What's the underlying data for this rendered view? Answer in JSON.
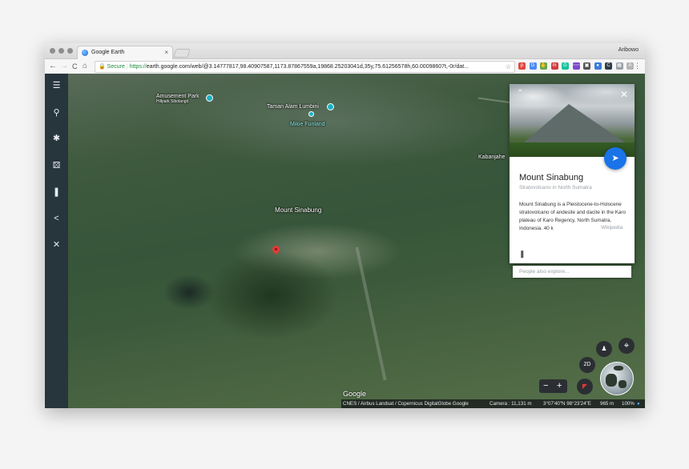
{
  "browser": {
    "tab_title": "Google Earth",
    "tab_close": "×",
    "user": "Aribowo",
    "nav": {
      "back": "←",
      "forward": "→",
      "reload": "C",
      "home": "⌂"
    },
    "secure_label": "Secure",
    "url_scheme": "https://",
    "url": "earth.google.com/web/@3.14777817,98.40907587,1173.87867559a,19868.25203041d,35y,75.61256578h,60.00098607t,-0r/dat...",
    "star": "☆",
    "extensions": [
      {
        "name": "pocket-ext",
        "glyph": "p",
        "color": "#e0463f"
      },
      {
        "name": "translate-ext",
        "glyph": "G",
        "color": "#4c8bf5"
      },
      {
        "name": "hand-ext",
        "glyph": "✋",
        "color": "#6aa84f"
      },
      {
        "name": "m-ext",
        "glyph": "m",
        "color": "#d23c3c"
      },
      {
        "name": "grammarly-ext",
        "glyph": "G",
        "color": "#15c39a"
      },
      {
        "name": "wappalyzer-ext",
        "glyph": "~~~",
        "color": "#7a49c9"
      },
      {
        "name": "stack-ext",
        "glyph": "▣",
        "color": "#555555"
      },
      {
        "name": "dot-ext",
        "glyph": "●",
        "color": "#3a7bd5"
      },
      {
        "name": "c-ext",
        "glyph": "C",
        "color": "#2d3b45"
      },
      {
        "name": "grid-ext",
        "glyph": "▦",
        "color": "#9aa0a6"
      },
      {
        "name": "a-ext",
        "glyph": "A",
        "color": "#b5b5b5"
      }
    ],
    "menu": "⋮"
  },
  "rail": [
    {
      "name": "menu-icon",
      "glyph": "☰"
    },
    {
      "name": "search-icon",
      "glyph": "⚲"
    },
    {
      "name": "voyager-icon",
      "glyph": "✱"
    },
    {
      "name": "random-dice-icon",
      "glyph": "⚄"
    },
    {
      "name": "bookmark-icon",
      "glyph": "❚"
    },
    {
      "name": "share-icon",
      "glyph": "<"
    },
    {
      "name": "measure-icon",
      "glyph": "✕"
    }
  ],
  "map": {
    "places": {
      "amusement_park": "Amusement Park",
      "hillpark": "Hillpark Sibolangit",
      "taman": "Taman Alam Lumbini",
      "mikie": "Mikie Funland",
      "kabanjahe": "Kabanjahe",
      "mount": "Mount Sinabung"
    },
    "google_logo": "Google"
  },
  "card": {
    "title": "Mount Sinabung",
    "subtitle": "Stratovolcano in North Sumatra",
    "description": "Mount Sinabung is a Pleistocene-to-Holocene stratovolcano of andesite and dacite in the Karo plateau of Karo Regency, North Sumatra, Indonesia. 40 k",
    "source": "Wikipedia",
    "close": "✕",
    "collapse": "⌃",
    "fly_to": "➤",
    "bookmark": "❚"
  },
  "explore": {
    "placeholder": "People also explore..."
  },
  "controls": {
    "pegman": "♟",
    "locate": "⌖",
    "toggle_2d": "2D",
    "zoom_out": "−",
    "zoom_in": "+",
    "compass": "◤"
  },
  "status": {
    "attribution": "CNES / Airbus  Landsat / Copernicus  DigitalGlobe  Google",
    "camera": "Camera :  11,131 m",
    "coords": "3°07'40\"N 98°23'24\"E",
    "elevation": "965 m",
    "zoom_pct": "100%"
  }
}
